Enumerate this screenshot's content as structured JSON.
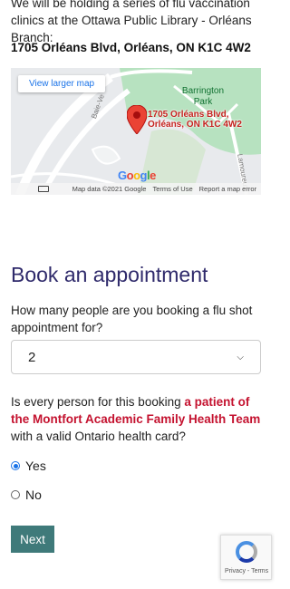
{
  "location": {
    "intro": "We will be holding a series of flu vaccination clinics at the Ottawa Public Library - Orléans Branch:",
    "address": "1705 Orléans Blvd, Orléans, ON K1C 4W2"
  },
  "map": {
    "view_larger_label": "View larger map",
    "park_label": "Barrington Park",
    "pin_label_line1": "1705 Orléans Blvd,",
    "pin_label_line2": "Orléans, ON K1C 4W2",
    "road_label_1": "Baie-Ve",
    "road_label_2": "Lamoureux",
    "logo_letters": [
      "G",
      "o",
      "o",
      "g",
      "l",
      "e"
    ],
    "footer": {
      "data": "Map data ©2021 Google",
      "terms": "Terms of Use",
      "report": "Report a map error"
    }
  },
  "booking": {
    "heading": "Book an appointment",
    "count_question": "How many people are you booking a flu shot appointment for?",
    "count_value": "2",
    "eligibility_prefix": "Is every person for this booking ",
    "eligibility_highlight": "a patient of the Montfort Academic Family Health Team",
    "eligibility_suffix": " with a valid Ontario health card?",
    "options": [
      {
        "label": "Yes",
        "checked": true
      },
      {
        "label": "No",
        "checked": false
      }
    ],
    "next_label": "Next"
  },
  "recaptcha": {
    "privacy": "Privacy",
    "separator": " - ",
    "terms": "Terms"
  },
  "colors": {
    "heading": "#2f2a6b",
    "highlight": "#c4122f",
    "button": "#3f7a7a",
    "link": "#1a73e8"
  }
}
